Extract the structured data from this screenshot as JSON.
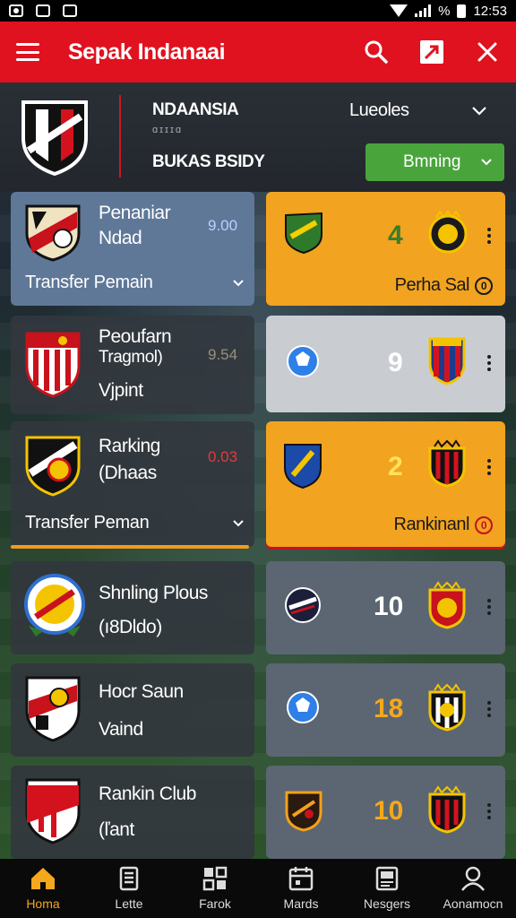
{
  "status_bar": {
    "time": "12:53",
    "battery_text": "%"
  },
  "app_bar": {
    "title": "Sepak Indanaai",
    "icons": [
      "menu-icon",
      "search-icon",
      "share-icon",
      "close-icon"
    ]
  },
  "header": {
    "team": "NDAANSIA",
    "sub": "ɑɪɪɪɑ",
    "group": "BUKAS BSIDY",
    "league": "Lueoles",
    "button": "Bmning"
  },
  "rows": [
    {
      "left": {
        "name": "Penaniar",
        "sub": "Ndad",
        "value": "9.00",
        "footer": "Transfer  Pemain",
        "style": "blue"
      },
      "right": {
        "score": "4",
        "footer": "Perha Sal",
        "style": "orange",
        "score_color": "#3a7d2a"
      }
    },
    {
      "left": {
        "name": "Peoufarn",
        "sub": "Tragmol)",
        "extra": "Vjpint",
        "value": "9.54",
        "style": "dark"
      },
      "right": {
        "score": "9",
        "style": "grey",
        "score_color": "#ffffff"
      }
    },
    {
      "left": {
        "name": "Rarking",
        "sub": "(Dhaas",
        "value": "0.03",
        "footer": "Transfer  Peman",
        "style": "dark"
      },
      "right": {
        "score": "2",
        "footer": "Rankinanl",
        "style": "orange",
        "score_color": "#ffe35a"
      }
    },
    {
      "left": {
        "name": "Shnling Plous",
        "sub": "(ı8Dldo)",
        "style": "dark"
      },
      "right": {
        "score": "10",
        "style": "slate",
        "score_color": "#ffffff"
      }
    },
    {
      "left": {
        "name": "Hocr Saun",
        "sub": "Vaind",
        "style": "dark"
      },
      "right": {
        "score": "18",
        "style": "slate",
        "score_color": "#f6a81c"
      }
    },
    {
      "left": {
        "name": "Rankin Club",
        "sub": "(ľant",
        "style": "dark"
      },
      "right": {
        "score": "10",
        "style": "slate",
        "score_color": "#f6a81c"
      }
    }
  ],
  "bottom_nav": [
    {
      "label": "Homa",
      "icon": "home-icon",
      "active": true
    },
    {
      "label": "Lette",
      "icon": "cards-icon",
      "active": false
    },
    {
      "label": "Farok",
      "icon": "grid-icon",
      "active": false
    },
    {
      "label": "Mards",
      "icon": "calendar-icon",
      "active": false
    },
    {
      "label": "Nesgers",
      "icon": "news-icon",
      "active": false
    },
    {
      "label": "Aonamocn",
      "icon": "profile-icon",
      "active": false
    }
  ],
  "colors": {
    "accent_red": "#e0121f",
    "accent_orange": "#f2a320",
    "accent_green": "#4aa43c",
    "nav_active": "#f6a81c"
  }
}
